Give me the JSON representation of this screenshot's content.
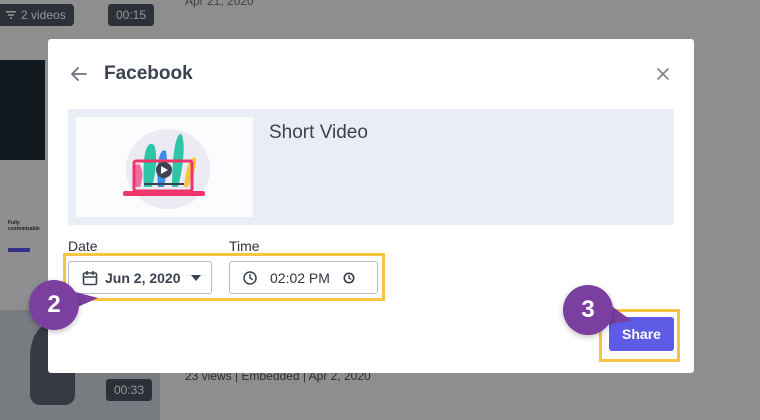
{
  "background": {
    "playlist_chip": "2 videos",
    "top_duration": "00:15",
    "top_date": "Apr 21, 2020",
    "thumb_caption": "Fully customizable",
    "bottom_duration": "00:33",
    "bottom_meta": "23 views  |  Embedded  |  Apr 2, 2020"
  },
  "modal": {
    "title": "Facebook",
    "video_title": "Short Video",
    "date_label": "Date",
    "date_value": "Jun 2, 2020",
    "time_label": "Time",
    "time_value": "02:02 PM",
    "share_label": "Share"
  },
  "annotations": {
    "step_fields": "2",
    "step_share": "3"
  },
  "colors": {
    "accent": "#5e5ce6",
    "callout": "#7b3fa0",
    "highlight": "#f5c542"
  }
}
